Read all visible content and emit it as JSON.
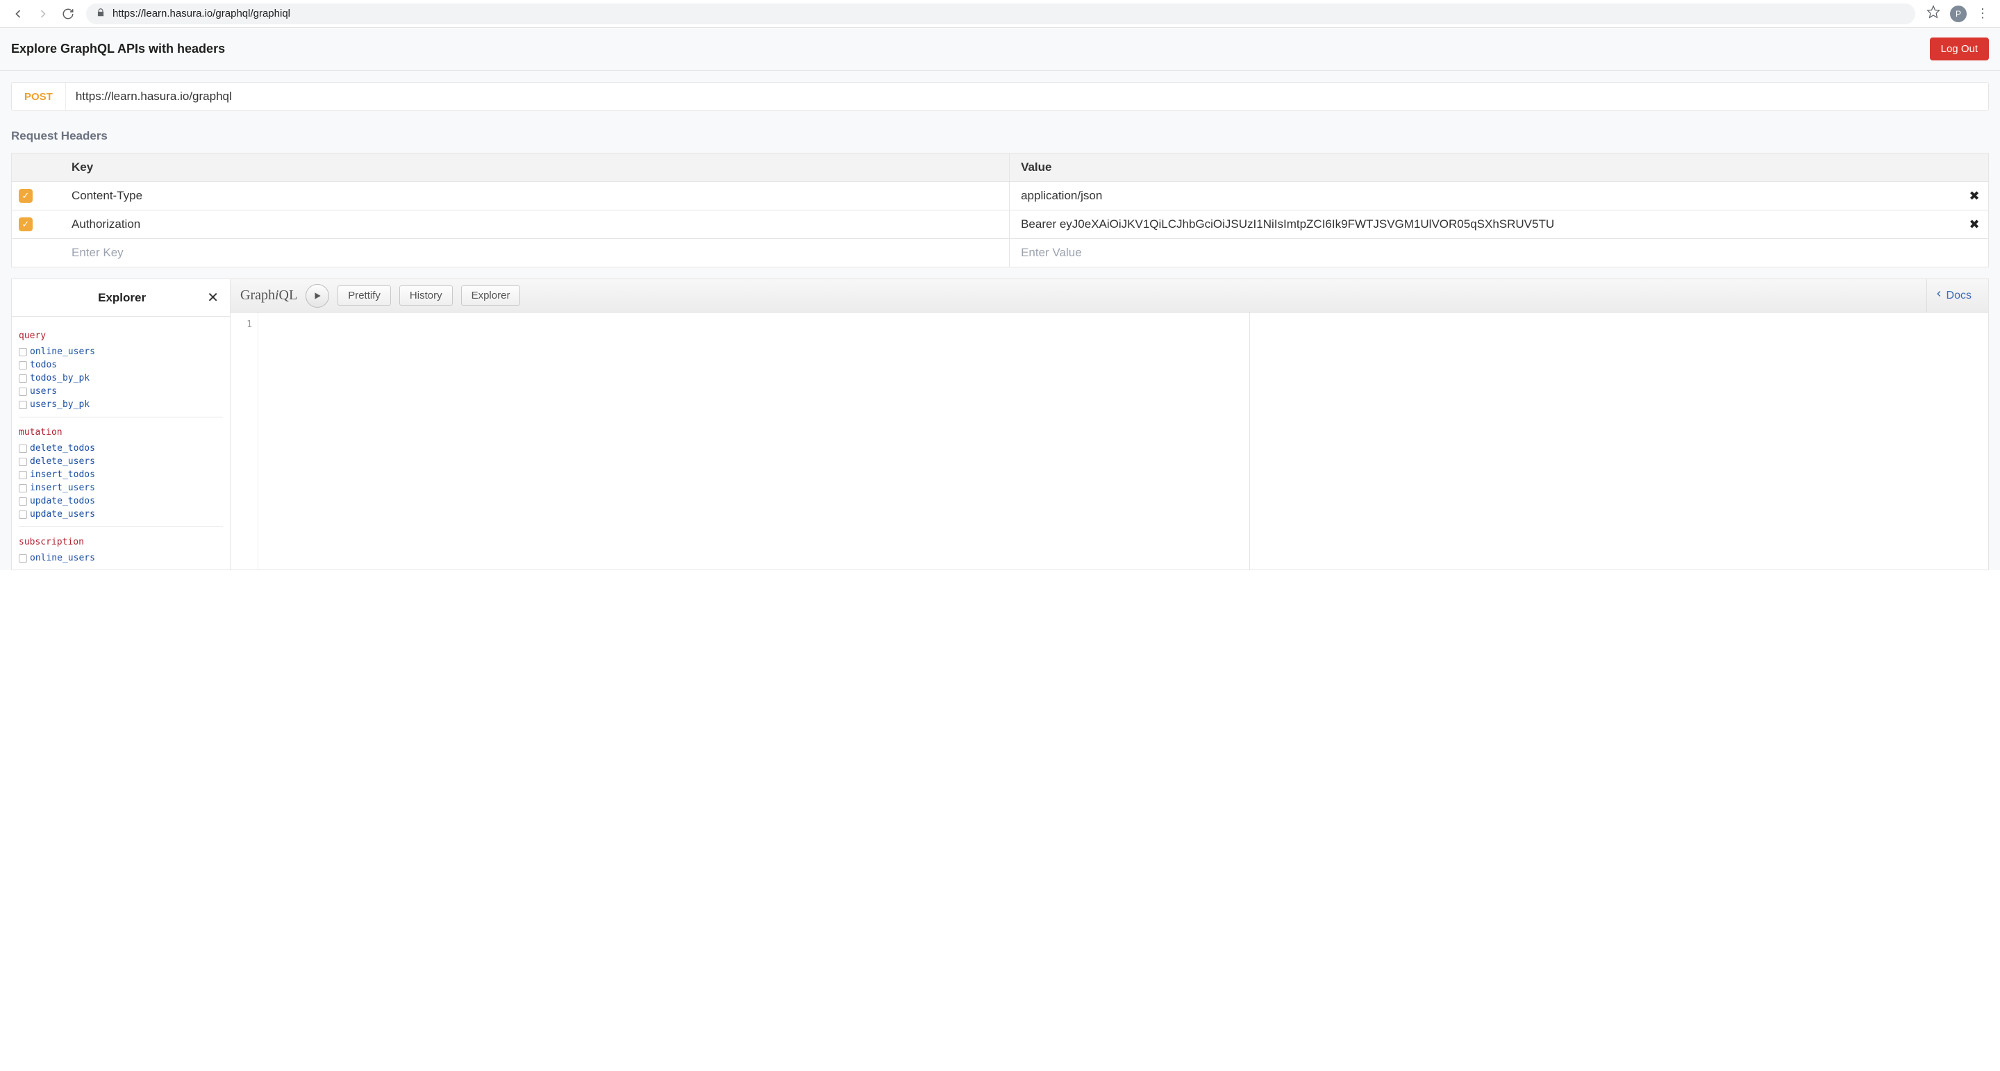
{
  "browser": {
    "url": "https://learn.hasura.io/graphql/graphiql",
    "avatar_letter": "P"
  },
  "header": {
    "title": "Explore GraphQL APIs with headers",
    "logout_label": "Log Out"
  },
  "endpoint": {
    "method": "POST",
    "url": "https://learn.hasura.io/graphql"
  },
  "request_headers": {
    "section_title": "Request Headers",
    "key_col": "Key",
    "value_col": "Value",
    "rows": [
      {
        "enabled": true,
        "key": "Content-Type",
        "value": "application/json"
      },
      {
        "enabled": true,
        "key": "Authorization",
        "value": "Bearer eyJ0eXAiOiJKV1QiLCJhbGciOiJSUzI1NiIsImtpZCI6Ik9FWTJSVGM1UlVOR05qSXhSRUV5TU"
      }
    ],
    "key_placeholder": "Enter Key",
    "value_placeholder": "Enter Value"
  },
  "explorer": {
    "title": "Explorer",
    "groups": [
      {
        "op": "query",
        "fields": [
          "online_users",
          "todos",
          "todos_by_pk",
          "users",
          "users_by_pk"
        ]
      },
      {
        "op": "mutation",
        "fields": [
          "delete_todos",
          "delete_users",
          "insert_todos",
          "insert_users",
          "update_todos",
          "update_users"
        ]
      },
      {
        "op": "subscription",
        "fields": [
          "online_users"
        ]
      }
    ]
  },
  "graphiql": {
    "logo": "GraphiQL",
    "prettify": "Prettify",
    "history": "History",
    "explorer": "Explorer",
    "docs": "Docs",
    "line_number": "1"
  }
}
